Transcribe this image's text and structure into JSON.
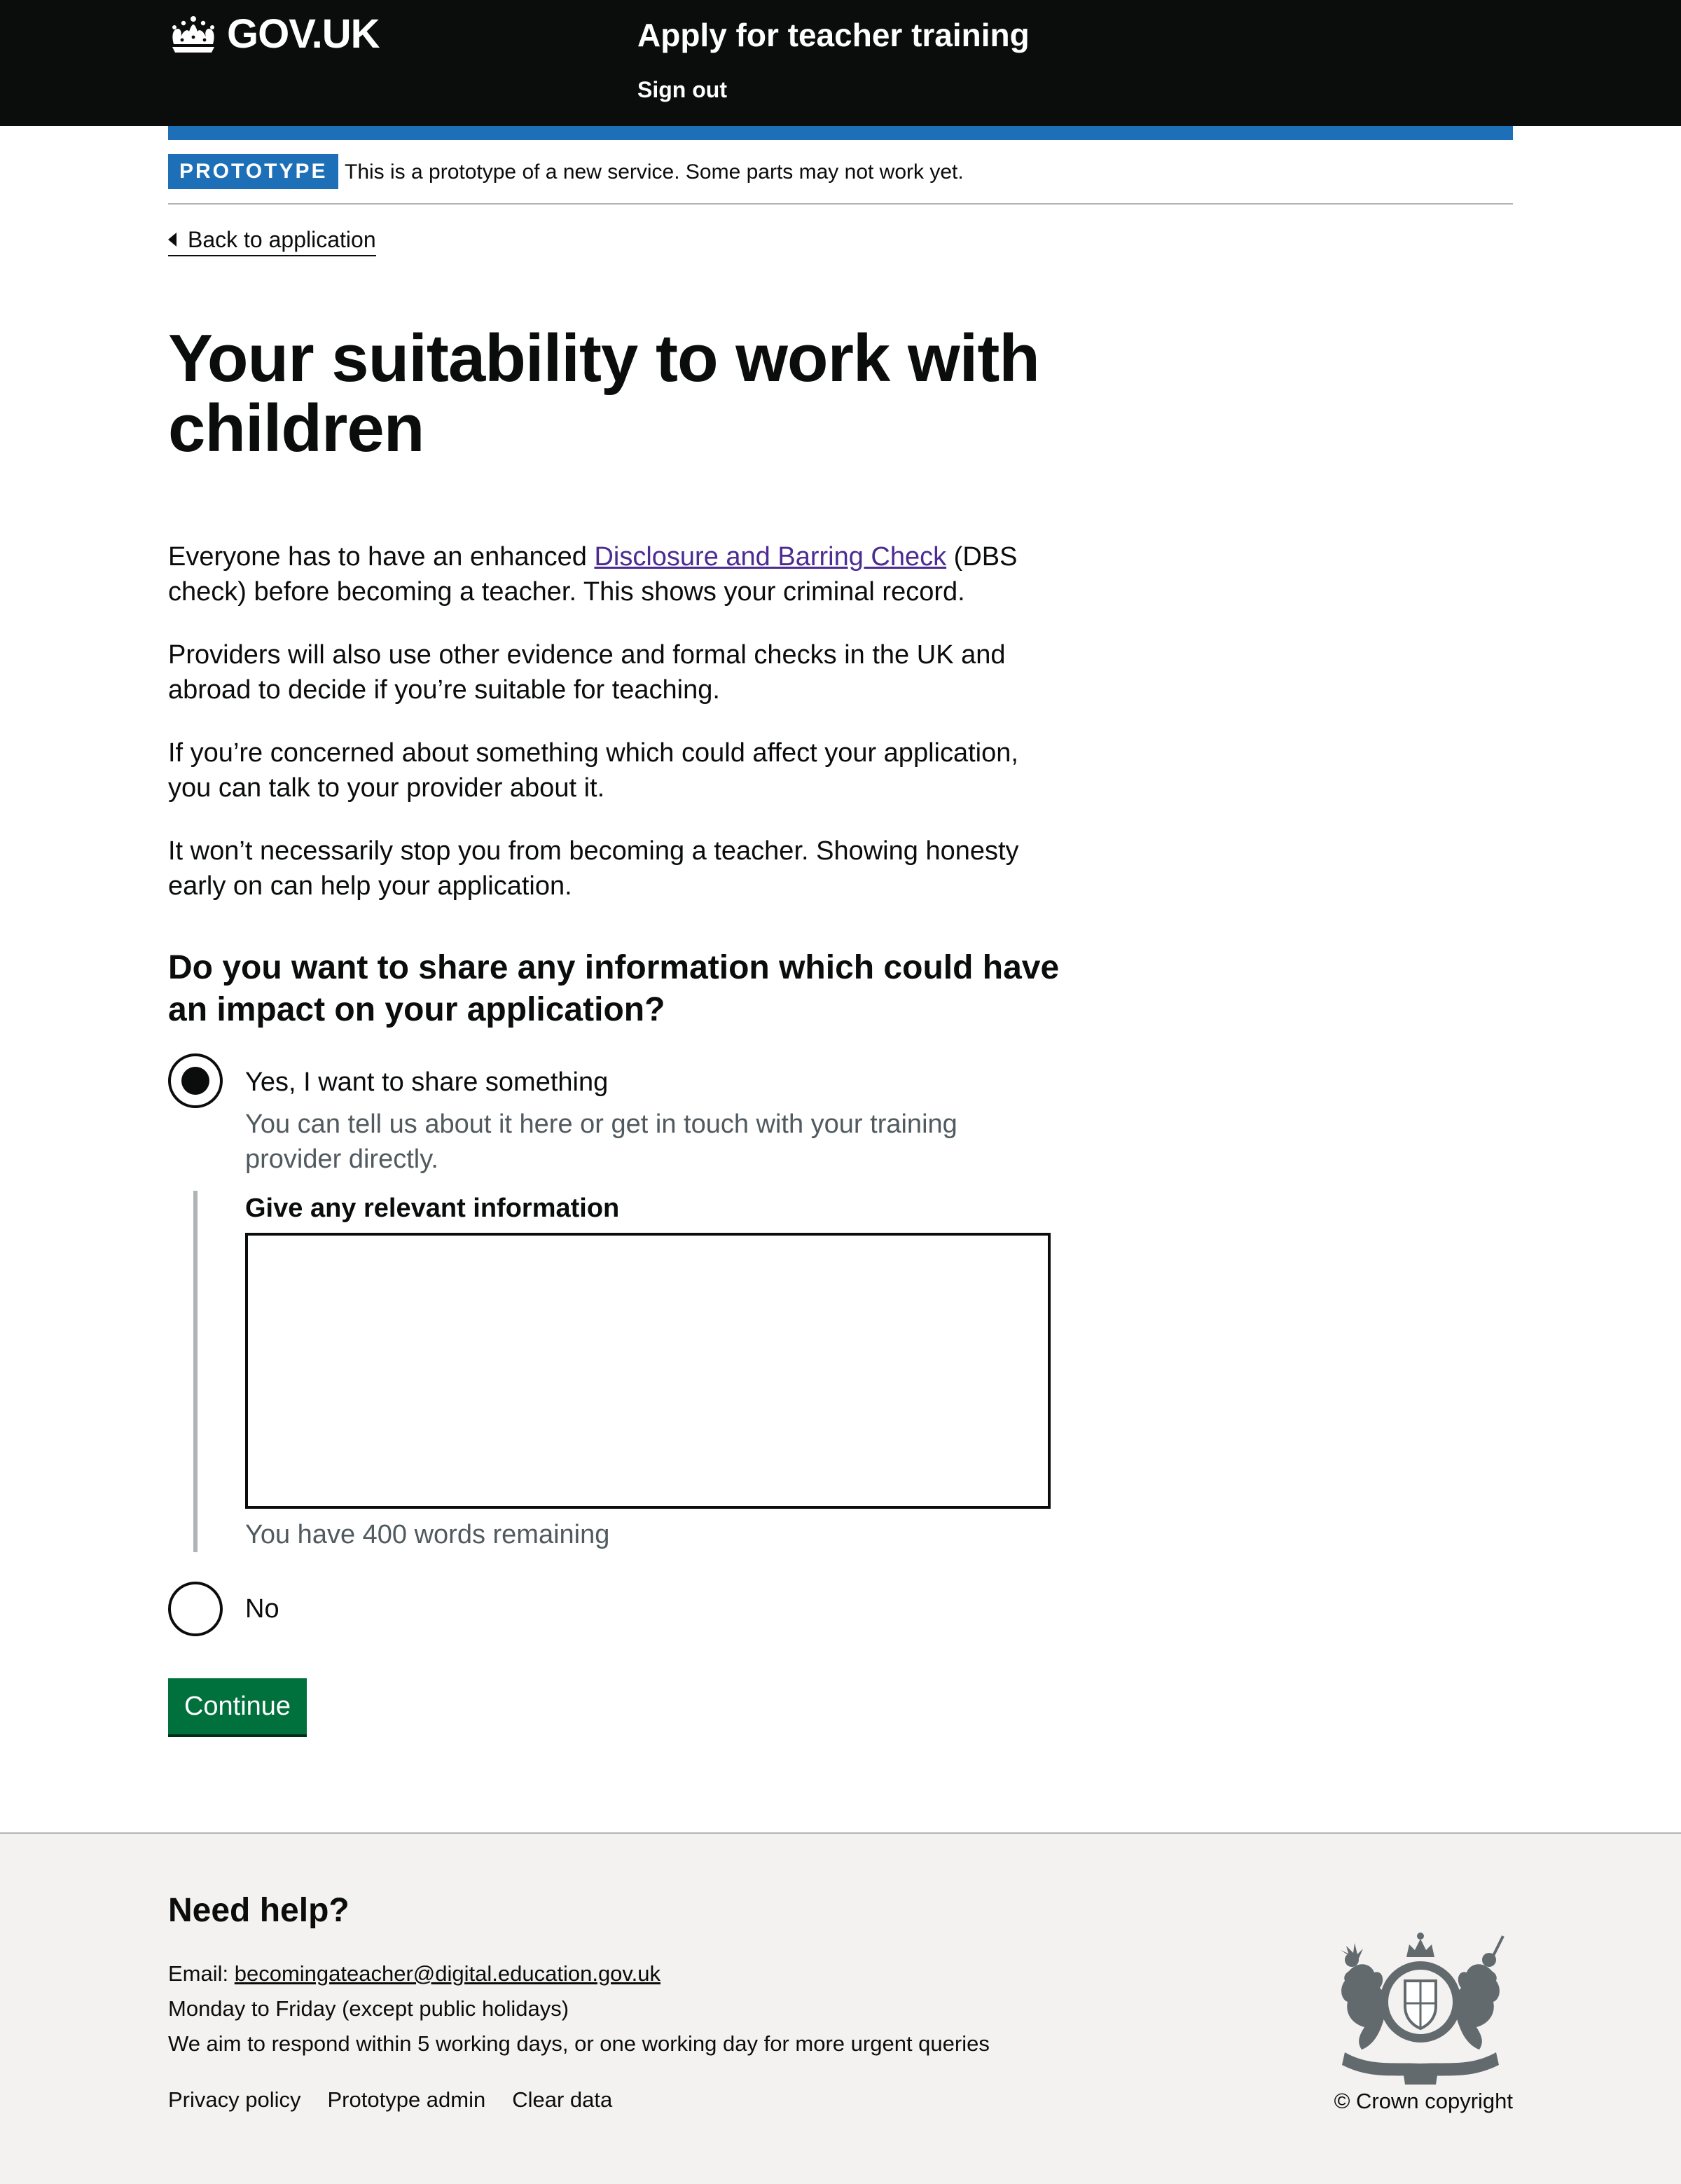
{
  "header": {
    "logo_text": "GOV.UK",
    "service_name": "Apply for teacher training",
    "sign_out": "Sign out"
  },
  "phase_banner": {
    "tag": "PROTOTYPE",
    "text": "This is a prototype of a new service. Some parts may not work yet."
  },
  "back_link": "Back to application",
  "page_title": "Your suitability to work with children",
  "intro": {
    "p1_before": "Everyone has to have an enhanced ",
    "p1_link": "Disclosure and Barring Check",
    "p1_after": " (DBS check) before becoming a teacher. This shows your criminal record.",
    "p2": "Providers will also use other evidence and formal checks in the UK and abroad to decide if you’re suitable for teaching.",
    "p3": "If you’re concerned about something which could affect your application, you can talk to your provider about it.",
    "p4": "It won’t necessarily stop you from becoming a teacher. Showing honesty early on can help your application."
  },
  "question": {
    "legend": "Do you want to share any information which could have an impact on your application?",
    "option_yes": "Yes, I want to share something",
    "option_yes_hint": "You can tell us about it here or get in touch with your training provider directly.",
    "yes_selected": true,
    "field_label": "Give any relevant information",
    "field_value": "",
    "word_count": "You have 400 words remaining",
    "option_no": "No",
    "no_selected": false
  },
  "continue_button": "Continue",
  "footer": {
    "heading": "Need help?",
    "email_label": "Email: ",
    "email": "becomingateacher@digital.education.gov.uk",
    "hours": "Monday to Friday (except public holidays)",
    "response": "We aim to respond within 5 working days, or one working day for more urgent queries",
    "links": [
      "Privacy policy",
      "Prototype admin",
      "Clear data"
    ],
    "copyright": "© Crown copyright"
  },
  "colors": {
    "header_bg": "#0b0c0c",
    "brand_blue": "#1d70b8",
    "button_green": "#00703c",
    "visited_link": "#4c2c92",
    "hint_grey": "#505a5f",
    "footer_bg": "#f3f2f1"
  },
  "icons": {
    "logo": "crown-icon",
    "back": "chevron-left-icon",
    "crest": "royal-coat-of-arms-icon"
  }
}
